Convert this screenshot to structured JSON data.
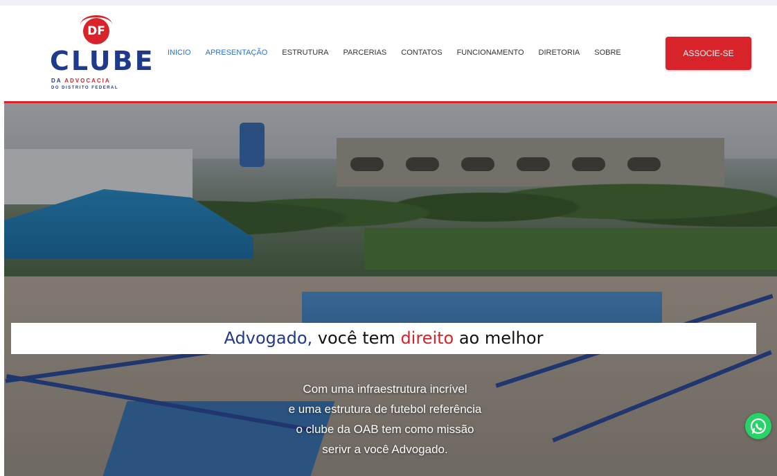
{
  "logo": {
    "badge": "DF",
    "main": "CLUBE",
    "sub_da": "DA",
    "sub_advocacia": "ADVOCACIA",
    "sub_line2": "DO DISTRITO FEDERAL"
  },
  "nav": {
    "items": [
      {
        "label": "INICIO",
        "active": true
      },
      {
        "label": "APRESENTAÇÃO",
        "active": true
      },
      {
        "label": "ESTRUTURA"
      },
      {
        "label": "PARCERIAS"
      },
      {
        "label": "CONTATOS"
      },
      {
        "label": "FUNCIONAMENTO"
      },
      {
        "label": "DIRETORIA"
      },
      {
        "label": "SOBRE"
      }
    ],
    "cta": "ASSOCIE-SE"
  },
  "hero": {
    "tagline": {
      "part1": "Advogado,",
      "part2": " você tem ",
      "part3": "direito",
      "part4": " ao melhor"
    },
    "desc_lines": [
      "Com uma infraestrutura incrível",
      "e uma estrutura de futebol referência",
      "o clube da OAB tem como missão",
      "serivr a você Advogado."
    ]
  },
  "colors": {
    "brand_red": "#d8232a",
    "brand_blue": "#1f3a8a",
    "nav_active": "#2a72d4",
    "whatsapp": "#25d366"
  },
  "icons": {
    "whatsapp": "whatsapp-icon"
  }
}
